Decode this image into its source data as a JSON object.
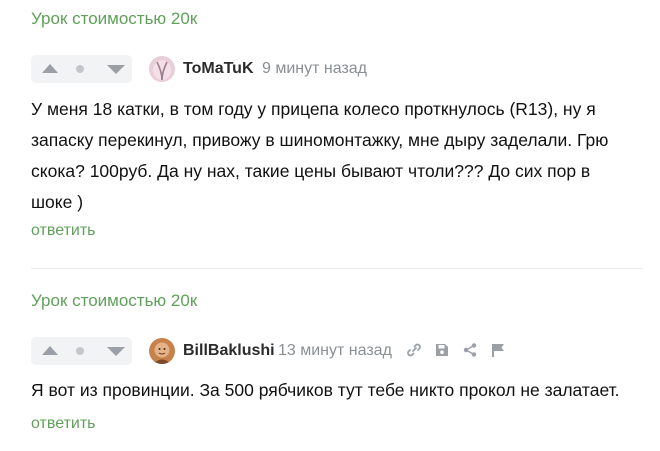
{
  "comments": [
    {
      "post_title": "Урок стоимостью 20к",
      "author": "ToMaTuK",
      "time": "9 минут назад",
      "text": "У меня 18 катки, в том году у прицепа колесо проткнулось (R13), ну я запаску перекинул, привожу в шиномонтажку, мне дыру заделали. Грю скока? 100руб. Да ну нах, такие цены бывают чтоли??? До сих пор в шоке )",
      "reply_label": "ответить"
    },
    {
      "post_title": "Урок стоимостью 20к",
      "author": "BillBaklushi",
      "time": "13 минут назад",
      "text": "Я вот из провинции. За 500 рябчиков тут тебе никто прокол не залатает.",
      "reply_label": "ответить",
      "tools": [
        "link-icon",
        "save-icon",
        "share-icon",
        "report-flag-icon"
      ]
    }
  ],
  "colors": {
    "accent_green": "#60a05a",
    "vote_bg": "#f2f3f5",
    "muted": "#8a8f94"
  }
}
